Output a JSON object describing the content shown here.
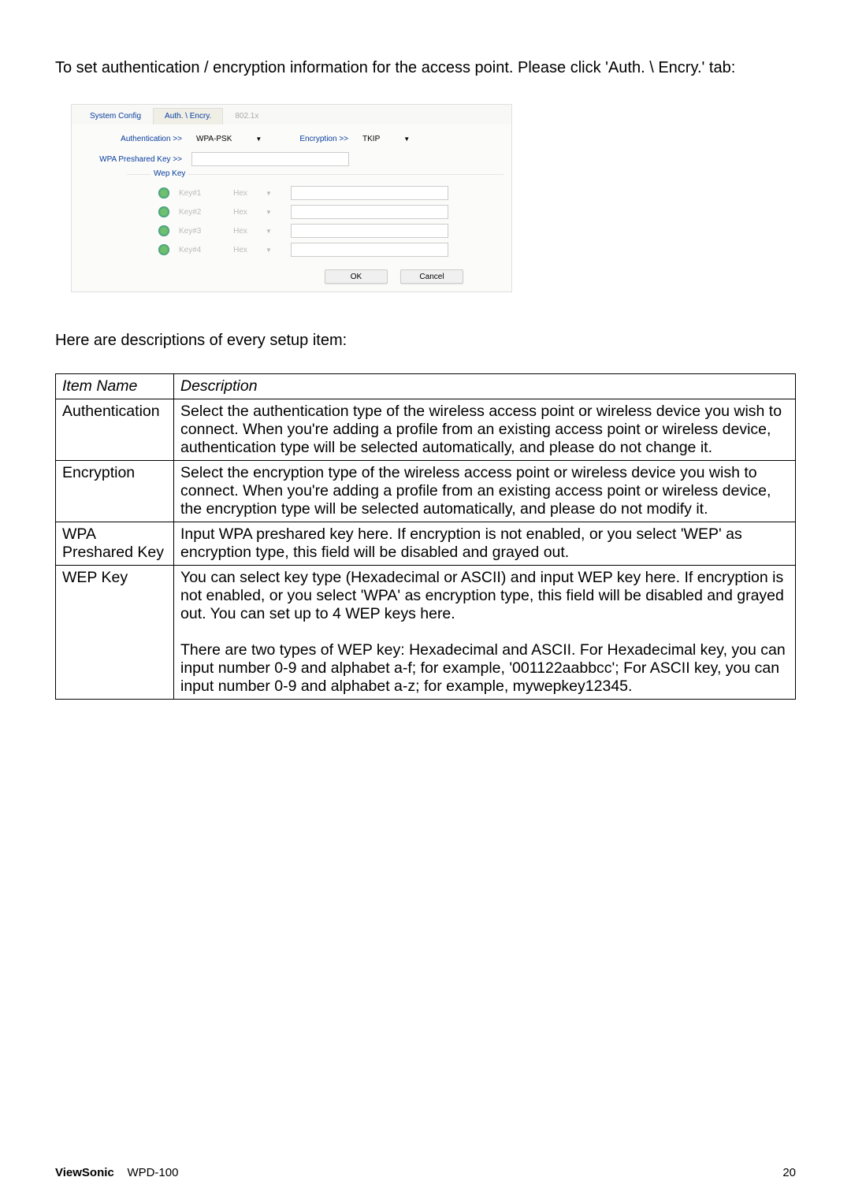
{
  "intro": "To set authentication / encryption information for the access point. Please click 'Auth. \\ Encry.' tab:",
  "dialog": {
    "tabs": {
      "system_config": "System Config",
      "auth_encry": "Auth. \\ Encry.",
      "t8021x": "802.1x"
    },
    "auth_label": "Authentication >>",
    "auth_value": "WPA-PSK",
    "enc_label": "Encryption >>",
    "enc_value": "TKIP",
    "psk_label": "WPA Preshared Key >>",
    "psk_value": "",
    "wep_legend": "Wep Key",
    "wep_rows": [
      {
        "label": "Key#1",
        "type": "Hex"
      },
      {
        "label": "Key#2",
        "type": "Hex"
      },
      {
        "label": "Key#3",
        "type": "Hex"
      },
      {
        "label": "Key#4",
        "type": "Hex"
      }
    ],
    "ok": "OK",
    "cancel": "Cancel"
  },
  "desc_intro": "Here are descriptions of every setup item:",
  "table": {
    "header_name": "Item Name",
    "header_desc": "Description",
    "rows": [
      {
        "name": "Authentication",
        "desc": "Select the authentication type of the wireless access point or wireless device you wish to connect. When you're adding a profile from an existing access point or wireless device, authentication type will be selected automatically, and please do not change it."
      },
      {
        "name": "Encryption",
        "desc": "Select the encryption type of the wireless access point or wireless device you wish to connect. When you're adding a profile from an existing access point or wireless device, the encryption type will be selected automatically, and please do not modify it."
      },
      {
        "name": "WPA Preshared Key",
        "desc": "Input WPA preshared key here. If encryption is not enabled, or you select 'WEP' as encryption type, this field will be disabled and grayed out."
      },
      {
        "name": "WEP Key",
        "desc": "You can select key type (Hexadecimal or ASCII) and input WEP key here. If encryption is not enabled, or you select 'WPA' as encryption type, this field will be disabled and grayed out. You can set up to 4 WEP keys here.\n\nThere are two types of WEP key: Hexadecimal and ASCII. For Hexadecimal key, you can input number 0-9 and alphabet a-f; for example, '001122aabbcc'; For ASCII key, you can input number 0-9 and alphabet a-z; for example, mywepkey12345."
      }
    ]
  },
  "footer": {
    "brand": "ViewSonic",
    "model": "WPD-100",
    "page": "20"
  }
}
